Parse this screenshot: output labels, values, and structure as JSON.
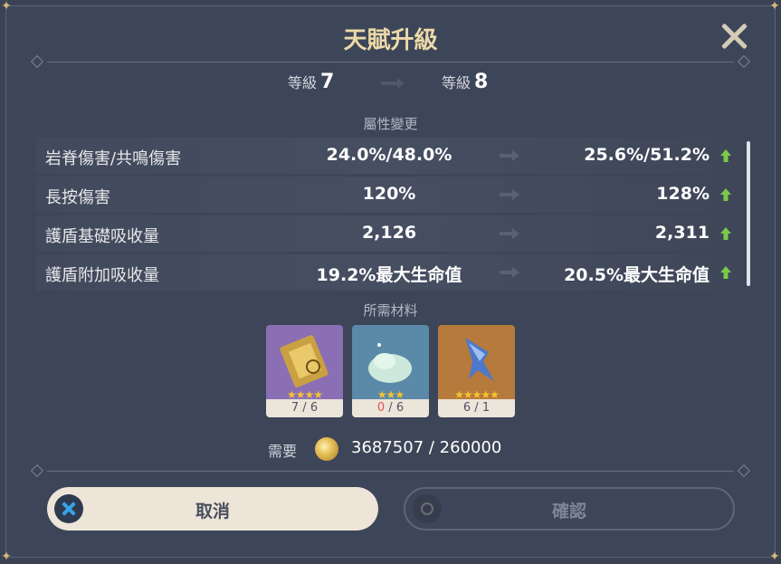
{
  "dialog": {
    "title": "天賦升級",
    "close_icon": "close-icon"
  },
  "levels": {
    "label": "等級",
    "current": "7",
    "next": "8"
  },
  "stats": {
    "heading": "屬性變更",
    "rows": [
      {
        "name": "岩脊傷害/共鳴傷害",
        "from": "24.0%/48.0%",
        "to": "25.6%/51.2%"
      },
      {
        "name": "長按傷害",
        "from": "120%",
        "to": "128%"
      },
      {
        "name": "護盾基礎吸收量",
        "from": "2,126",
        "to": "2,311"
      },
      {
        "name": "護盾附加吸收量",
        "from": "19.2%最大生命值",
        "to": "20.5%最大生命值"
      }
    ]
  },
  "materials": {
    "heading": "所需材料",
    "items": [
      {
        "icon": "gold-book-icon",
        "stars": "★★★★",
        "owned": "7",
        "required": "6",
        "bg": "#8a6fb5"
      },
      {
        "icon": "slime-icon",
        "stars": "★★★",
        "owned": "0",
        "required": "6",
        "bg": "#5b89a8"
      },
      {
        "icon": "blue-crystal-icon",
        "stars": "★★★★★",
        "owned": "6",
        "required": "1",
        "bg": "#b57a3c"
      }
    ]
  },
  "cost": {
    "label": "需要",
    "coin_icon": "mora-coin-icon",
    "amount": "3687507 / 260000"
  },
  "buttons": {
    "cancel_label": "取消",
    "confirm_label": "確認"
  },
  "colors": {
    "title": "#ecd9a8",
    "panel": "#3d4558",
    "up_arrow": "#7bc94a",
    "shortage": "#e0544d"
  }
}
